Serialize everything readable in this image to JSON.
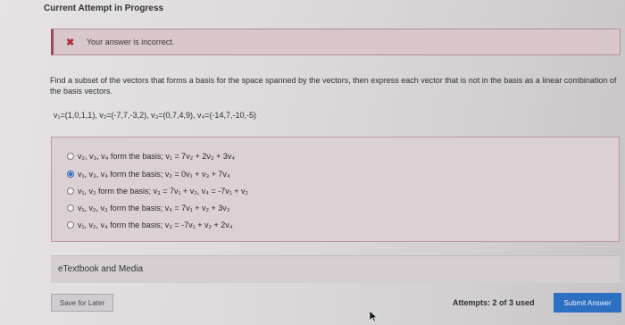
{
  "header": {
    "title": "Current Attempt in Progress"
  },
  "feedback": {
    "icon": "close-icon",
    "message": "Your answer is incorrect.",
    "color": "#b22a3b"
  },
  "question": {
    "prompt": "Find a subset of the vectors that forms a basis for the space spanned by the vectors, then express each vector that is not in the basis as a linear combination of the basis vectors.",
    "vectors": "v₁=(1,0,1,1), v₂=(-7,7,-3,2), v₃=(0,7,4,9), v₄=(-14,7,-10,-5)"
  },
  "options": [
    {
      "label": "v₂, v₃, v₄ form the basis; v₁ = 7v₂ + 2v₃ + 3v₄",
      "selected": false
    },
    {
      "label": "v₁, v₃, v₄ form the basis; v₂ = 0v₁ + v₃ + 7v₄",
      "selected": true
    },
    {
      "label": "v₁, v₂ form the basis; v₃ = 7v₁ + v₂, v₄ = -7v₁ + v₂",
      "selected": false
    },
    {
      "label": "v₁, v₂, v₃ form the basis; v₄ = 7v₁ + v₂ + 3v₃",
      "selected": false
    },
    {
      "label": "v₁, v₂, v₄ form the basis; v₃ = -7v₁ + v₂ + 2v₄",
      "selected": false
    }
  ],
  "resources": {
    "label": "eTextbook and Media"
  },
  "footer": {
    "save_label": "Save for Later",
    "attempts": "Attempts: 2 of 3 used",
    "submit_label": "Submit Answer",
    "accent": "#2d6fc0"
  }
}
